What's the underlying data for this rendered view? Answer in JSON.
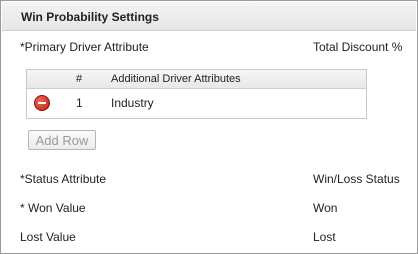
{
  "section": {
    "title": "Win Probability Settings"
  },
  "primary_driver": {
    "label": "*Primary Driver Attribute",
    "value": "Total Discount %"
  },
  "driver_table": {
    "columns": [
      "#",
      "Additional Driver Attributes"
    ],
    "rows": [
      {
        "number": "1",
        "attribute": "Industry",
        "action_icon": "remove-icon"
      }
    ]
  },
  "add_row_label": "Add Row",
  "status_attribute": {
    "label": "*Status Attribute",
    "value": "Win/Loss Status"
  },
  "won_value": {
    "label": "* Won Value",
    "value": "Won"
  },
  "lost_value": {
    "label": "Lost Value",
    "value": "Lost"
  },
  "colors": {
    "remove_icon": "#c62a1d",
    "header_bg": "#eeeeee",
    "border": "#9a9a9a"
  }
}
